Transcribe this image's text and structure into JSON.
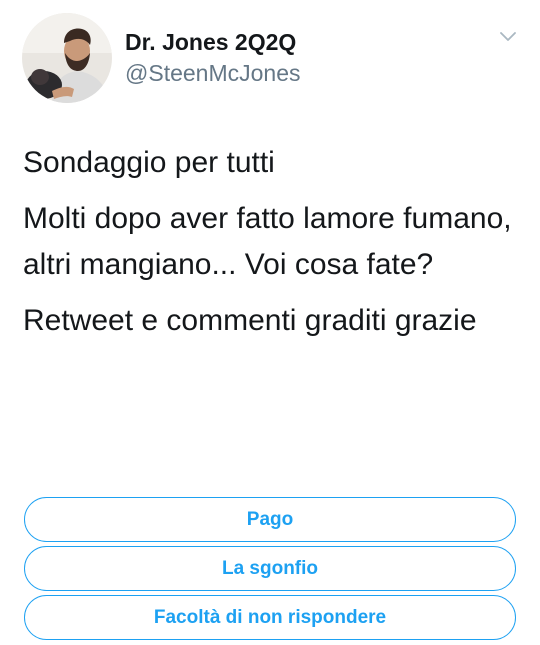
{
  "author": {
    "display_name": "Dr. Jones 2Q2Q",
    "handle": "@SteenMcJones",
    "avatar": "profile-photo"
  },
  "tweet": {
    "paragraphs": [
      "Sondaggio per tutti",
      "Molti dopo aver fatto lamore fumano, altri mangiano... Voi cosa fate?",
      "Retweet e commenti graditi grazie"
    ]
  },
  "poll": {
    "options": [
      "Pago",
      "La sgonfio",
      "Facoltà di non rispondere"
    ]
  },
  "icons": {
    "menu": "chevron-down-icon"
  },
  "colors": {
    "accent": "#1da1f2",
    "secondary_text": "#657786",
    "primary_text": "#14171a"
  }
}
